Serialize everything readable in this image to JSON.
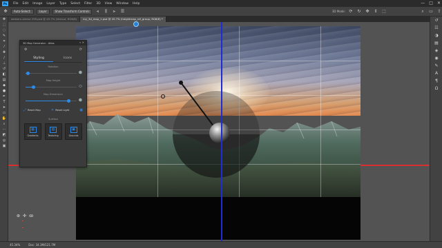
{
  "app": {
    "logo": "Ps"
  },
  "menu": [
    "File",
    "Edit",
    "Image",
    "Layer",
    "Type",
    "Select",
    "Filter",
    "3D",
    "View",
    "Window",
    "Help"
  ],
  "window_controls": [
    "—",
    "□",
    "✕"
  ],
  "options_bar": {
    "tool_preset": "Auto-Select:",
    "target": "Layer",
    "show_transform": "Show Transform Controls",
    "mode_3d": "3D Mode:"
  },
  "document_tabs": [
    {
      "label": "western-slense 299.psd @ 45.7% (Verlauf, RGB/8)",
      "active": false
    },
    {
      "label": "my_3d_map_1.psd @ 45.7% (heightmap_ref_group, RGB/8) *",
      "active": true
    }
  ],
  "status_bar": {
    "zoom": "45.34%",
    "doc": "Doc: 34.3M/121.7M"
  },
  "panel": {
    "title": "3D Map Generator - Atlas",
    "tabs": [
      {
        "label": "Styling",
        "active": true
      },
      {
        "label": "Icons",
        "active": false
      }
    ],
    "sections": {
      "rotation": "Rotation",
      "map_height": "Map Height",
      "map_dimension": "Map Dimension",
      "surface": "Surface"
    },
    "sliders": {
      "rotation": 0.05,
      "map_height": 0.15,
      "map_dimension": 0.85
    },
    "buttons": {
      "reset_map": "Reset Map",
      "reset_light": "Reset Light"
    },
    "surface_buttons": [
      {
        "label": "Gradients",
        "icon": "▦"
      },
      {
        "label": "Texturing",
        "icon": "▧"
      },
      {
        "label": "Grounds",
        "icon": "▣"
      }
    ]
  },
  "icons": {
    "left_tools": [
      "move-icon",
      "marquee-icon",
      "lasso-icon",
      "quick-select-icon",
      "crop-icon",
      "eyedropper-icon",
      "healing-icon",
      "brush-icon",
      "stamp-icon",
      "history-brush-icon",
      "eraser-icon",
      "gradient-icon",
      "blur-icon",
      "dodge-icon",
      "pen-icon",
      "type-icon",
      "path-select-icon",
      "shape-icon",
      "hand-icon",
      "zoom-icon",
      "edit-toolbar-icon",
      "color-swatch-icon",
      "quick-mask-icon",
      "screen-mode-icon"
    ],
    "right_tools": [
      "history-icon",
      "properties-icon",
      "adjustments-icon",
      "libraries-icon",
      "layers-icon",
      "channels-icon",
      "paths-icon",
      "character-icon",
      "paragraph-icon",
      "glyphs-icon"
    ]
  },
  "colors": {
    "accent": "#2d8ceb",
    "guide_blue": "#1e2bd6",
    "guide_red": "#d83030"
  }
}
